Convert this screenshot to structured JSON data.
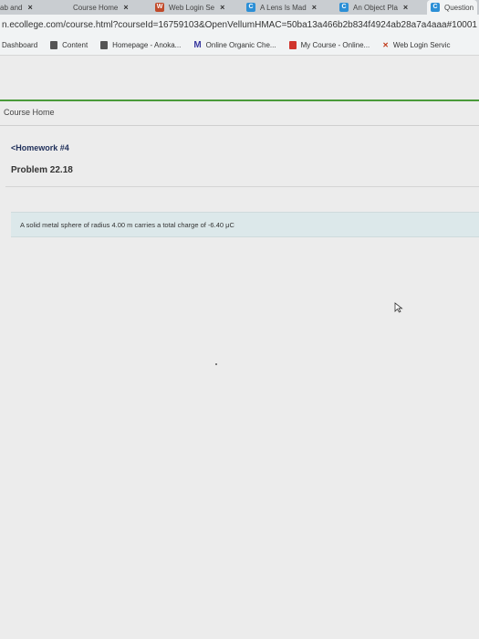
{
  "tabs": [
    {
      "label": "ab and",
      "close": "×"
    },
    {
      "label": "Course Home",
      "close": "×"
    },
    {
      "label": "Web Login Se",
      "close": "×"
    },
    {
      "label": "A Lens Is Mad",
      "close": "×"
    },
    {
      "label": "An Object Pla",
      "close": "×"
    },
    {
      "label": "Question",
      "close": ""
    }
  ],
  "address_bar": {
    "url": "n.ecollege.com/course.html?courseId=16759103&OpenVellumHMAC=50ba13a466b2b834f4924ab28a7a4aaa#10001"
  },
  "bookmarks": [
    {
      "label": "Dashboard"
    },
    {
      "label": "Content"
    },
    {
      "label": "Homepage - Anoka..."
    },
    {
      "label": "Online Organic Che..."
    },
    {
      "label": "My Course - Online..."
    },
    {
      "label": "Web Login Servic"
    }
  ],
  "page": {
    "course_home": "Course Home",
    "homework_link": "<Homework #4",
    "problem_title": "Problem 22.18",
    "question": "A solid metal sphere of radius 4.00 m carries a total charge of -6.40 μC"
  },
  "colors": {
    "accent_green": "#4a9a3a",
    "question_bg": "#dce8ea",
    "link_blue": "#1f2f5a"
  }
}
